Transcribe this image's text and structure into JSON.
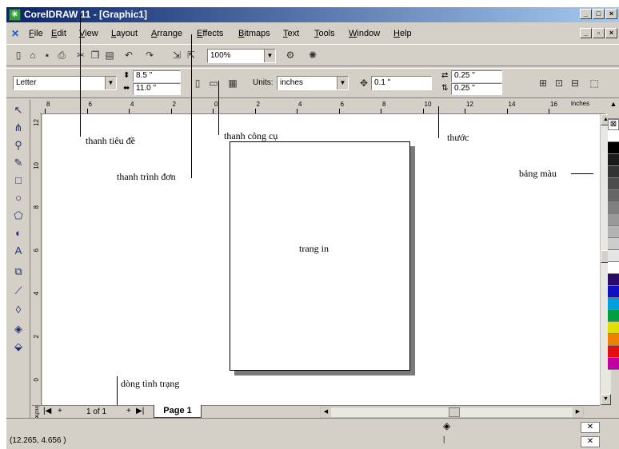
{
  "window": {
    "title": "CorelDRAW 11 - [Graphic1]",
    "icon": "coreldraw-icon"
  },
  "menubar": {
    "items": [
      "File",
      "Edit",
      "View",
      "Layout",
      "Arrange",
      "Effects",
      "Bitmaps",
      "Text",
      "Tools",
      "Window",
      "Help"
    ]
  },
  "toolbar_standard": {
    "zoom_value": "100%"
  },
  "toolbar_property": {
    "paper_size": "Letter",
    "width_value": "8.5 \"",
    "height_value": "11.0 \"",
    "units_label": "Units:",
    "units_value": "inches",
    "nudge_value": "0.1 \"",
    "dup_x_value": "0.25 \"",
    "dup_y_value": "0.25 \""
  },
  "ruler": {
    "unit": "inches",
    "h_ticks": [
      "8",
      "6",
      "4",
      "2",
      "0",
      "2",
      "4",
      "6",
      "8",
      "10",
      "12",
      "14",
      "16"
    ],
    "v_ticks": [
      "12",
      "10",
      "8",
      "6",
      "4",
      "2",
      "0"
    ]
  },
  "canvas": {
    "page_label": "trang in"
  },
  "annotations": {
    "title_bar": "thanh tiêu đề",
    "menu_bar": "thanh trình đơn",
    "toolbar": "thanh công cụ",
    "ruler": "thước",
    "palette": "bảng màu",
    "status_bar": "dòng tình trạng"
  },
  "page_nav": {
    "page_count": "1 of 1",
    "tab_label": "Page 1"
  },
  "status": {
    "coordinates": "(12.265, 4.656 )"
  },
  "palette_colors": [
    "#ffffff",
    "#000000",
    "#1a1a1a",
    "#333333",
    "#4d4d4d",
    "#666666",
    "#808080",
    "#999999",
    "#b3b3b3",
    "#cccccc",
    "#e6e6e6",
    "#ffffff",
    "#2a0a6a",
    "#1010c0",
    "#00a0e0",
    "#00a040",
    "#e0e000",
    "#f08000",
    "#e01010",
    "#c000a0"
  ]
}
